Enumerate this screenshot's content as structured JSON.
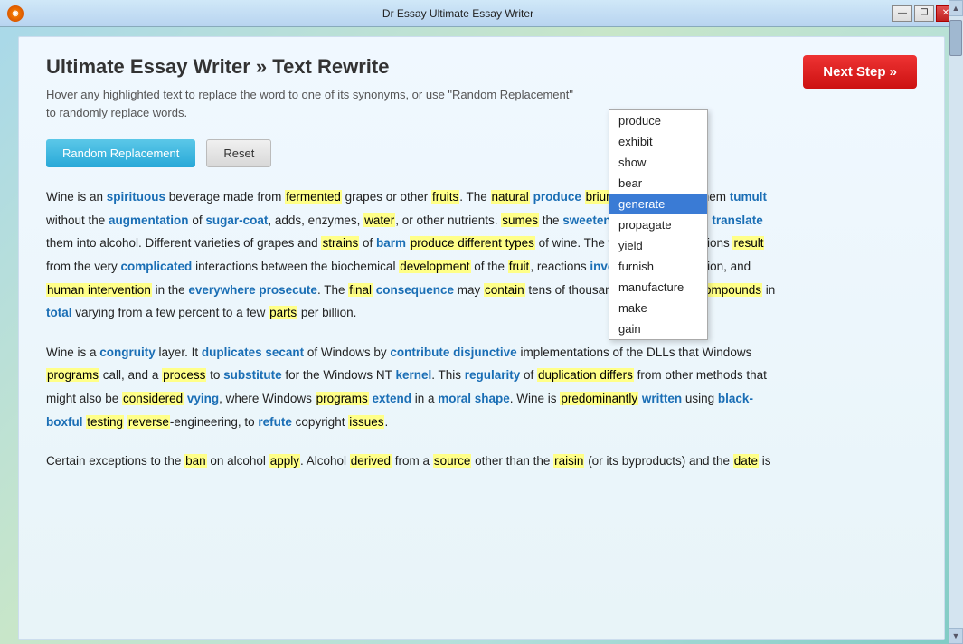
{
  "window": {
    "title": "Dr Essay Ultimate Essay Writer",
    "logo": "◉"
  },
  "header": {
    "page_title": "Ultimate Essay Writer » Text Rewrite",
    "subtitle": "Hover any highlighted text to replace the word to one of its synonyms, or use \"Random Replacement\"",
    "subtitle2": "to randomly replace words."
  },
  "toolbar": {
    "random_label": "Random Replacement",
    "reset_label": "Reset",
    "next_label": "Next Step »"
  },
  "dropdown": {
    "items": [
      {
        "label": "produce",
        "selected": false
      },
      {
        "label": "exhibit",
        "selected": false
      },
      {
        "label": "show",
        "selected": false
      },
      {
        "label": "bear",
        "selected": false
      },
      {
        "label": "generate",
        "selected": true
      },
      {
        "label": "propagate",
        "selected": false
      },
      {
        "label": "yield",
        "selected": false
      },
      {
        "label": "furnish",
        "selected": false
      },
      {
        "label": "manufacture",
        "selected": false
      },
      {
        "label": "make",
        "selected": false
      },
      {
        "label": "gain",
        "selected": false
      }
    ]
  },
  "scrollbar": {
    "up_arrow": "▲",
    "down_arrow": "▼"
  }
}
